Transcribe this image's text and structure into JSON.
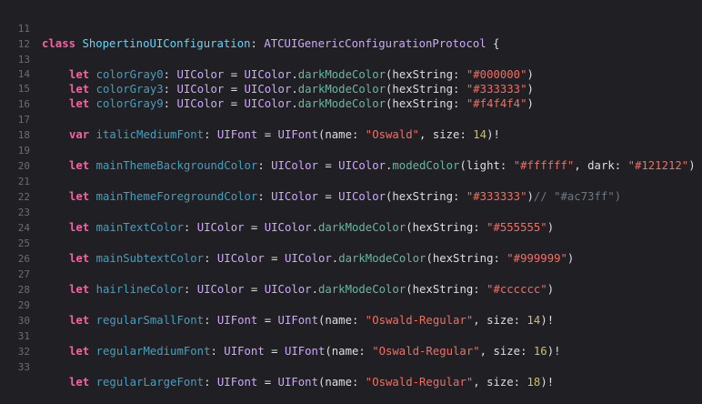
{
  "editor": {
    "line_numbers": [
      "11",
      "12",
      "13",
      "14",
      "15",
      "16",
      "17",
      "18",
      "19",
      "20",
      "21",
      "22",
      "23",
      "24",
      "25",
      "26",
      "27",
      "28",
      "29",
      "30",
      "31",
      "32",
      "33"
    ],
    "line11": {
      "kw": "class",
      "name": "ShopertinoUIConfiguration",
      "colon": ": ",
      "protocol": "ATCUIGenericConfigurationProtocol",
      "brace": " {"
    },
    "line13": {
      "kw": "let",
      "name": "colorGray0",
      "p1": ": ",
      "type": "UIColor",
      "p2": " = ",
      "cls": "UIColor",
      "dot": ".",
      "method": "darkModeColor",
      "p3": "(hexString: ",
      "str": "\"#000000\"",
      "end": ")"
    },
    "line14": {
      "kw": "let",
      "name": "colorGray3",
      "p1": ": ",
      "type": "UIColor",
      "p2": " = ",
      "cls": "UIColor",
      "dot": ".",
      "method": "darkModeColor",
      "p3": "(hexString: ",
      "str": "\"#333333\"",
      "end": ")"
    },
    "line15": {
      "kw": "let",
      "name": "colorGray9",
      "p1": ": ",
      "type": "UIColor",
      "p2": " = ",
      "cls": "UIColor",
      "dot": ".",
      "method": "darkModeColor",
      "p3": "(hexString: ",
      "str": "\"#f4f4f4\"",
      "end": ")"
    },
    "line17": {
      "kw": "var",
      "name": "italicMediumFont",
      "p1": ": ",
      "type": "UIFont",
      "p2": " = ",
      "cls": "UIFont",
      "p3": "(name: ",
      "str": "\"Oswald\"",
      "p4": ", size: ",
      "num": "14",
      "end": ")!"
    },
    "line19": {
      "kw": "let",
      "name": "mainThemeBackgroundColor",
      "p1": ": ",
      "type": "UIColor",
      "p2": " = ",
      "cls": "UIColor",
      "dot": ".",
      "method": "modedColor",
      "p3": "(light: ",
      "str1": "\"#ffffff\"",
      "p4": ", dark: ",
      "str2": "\"#121212\"",
      "end": ")"
    },
    "line21": {
      "kw": "let",
      "name": "mainThemeForegroundColor",
      "p1": ": ",
      "type": "UIColor",
      "p2": " = ",
      "cls": "UIColor",
      "p3": "(hexString: ",
      "str": "\"#333333\"",
      "end": ")",
      "comment": "// \"#ac73ff\")"
    },
    "line23": {
      "kw": "let",
      "name": "mainTextColor",
      "p1": ": ",
      "type": "UIColor",
      "p2": " = ",
      "cls": "UIColor",
      "dot": ".",
      "method": "darkModeColor",
      "p3": "(hexString: ",
      "str": "\"#555555\"",
      "end": ")"
    },
    "line25": {
      "kw": "let",
      "name": "mainSubtextColor",
      "p1": ": ",
      "type": "UIColor",
      "p2": " = ",
      "cls": "UIColor",
      "dot": ".",
      "method": "darkModeColor",
      "p3": "(hexString: ",
      "str": "\"#999999\"",
      "end": ")"
    },
    "line27": {
      "kw": "let",
      "name": "hairlineColor",
      "p1": ": ",
      "type": "UIColor",
      "p2": " = ",
      "cls": "UIColor",
      "dot": ".",
      "method": "darkModeColor",
      "p3": "(hexString: ",
      "str": "\"#cccccc\"",
      "end": ")"
    },
    "line29": {
      "kw": "let",
      "name": "regularSmallFont",
      "p1": ": ",
      "type": "UIFont",
      "p2": " = ",
      "cls": "UIFont",
      "p3": "(name: ",
      "str": "\"Oswald-Regular\"",
      "p4": ", size: ",
      "num": "14",
      "end": ")!"
    },
    "line31": {
      "kw": "let",
      "name": "regularMediumFont",
      "p1": ": ",
      "type": "UIFont",
      "p2": " = ",
      "cls": "UIFont",
      "p3": "(name: ",
      "str": "\"Oswald-Regular\"",
      "p4": ", size: ",
      "num": "16",
      "end": ")!"
    },
    "line33": {
      "kw": "let",
      "name": "regularLargeFont",
      "p1": ": ",
      "type": "UIFont",
      "p2": " = ",
      "cls": "UIFont",
      "p3": "(name: ",
      "str": "\"Oswald-Regular\"",
      "p4": ", size: ",
      "num": "18",
      "end": ")!"
    }
  }
}
